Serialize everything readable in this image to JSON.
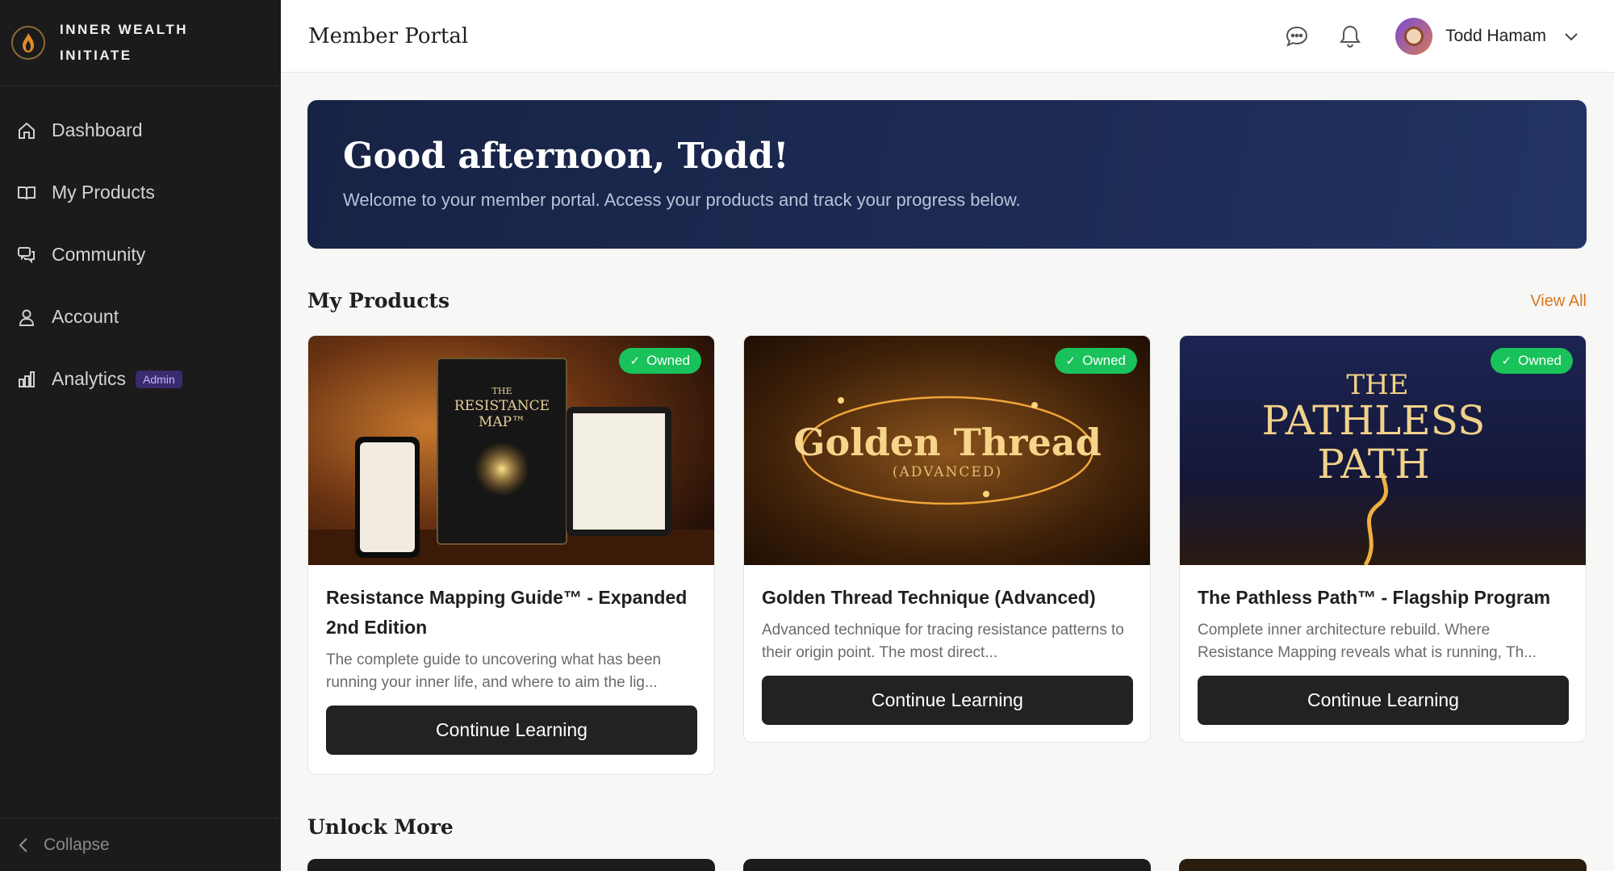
{
  "brand": {
    "line1": "INNER WEALTH",
    "line2": "INITIATE"
  },
  "sidebar": {
    "items": [
      {
        "label": "Dashboard",
        "icon": "home-icon"
      },
      {
        "label": "My Products",
        "icon": "book-icon"
      },
      {
        "label": "Community",
        "icon": "chat-icon"
      },
      {
        "label": "Account",
        "icon": "user-icon"
      },
      {
        "label": "Analytics",
        "icon": "bar-chart-icon",
        "badge": "Admin"
      }
    ],
    "collapse_label": "Collapse"
  },
  "header": {
    "title": "Member Portal",
    "user_name": "Todd Hamam"
  },
  "hero": {
    "title": "Good afternoon, Todd!",
    "subtitle": "Welcome to your member portal. Access your products and track your progress below."
  },
  "products": {
    "section_title": "My Products",
    "view_all": "View All",
    "cards": [
      {
        "badge": "Owned",
        "image_text": [
          "THE",
          "RESISTANCE",
          "MAP™"
        ],
        "title": "Resistance Mapping Guide™ - Expanded 2nd Edition",
        "description": "The complete guide to uncovering what has been running your inner life, and where to aim the lig...",
        "button": "Continue Learning"
      },
      {
        "badge": "Owned",
        "image_text": [
          "Golden Thread",
          "(ADVANCED)"
        ],
        "title": "Golden Thread Technique (Advanced)",
        "description": "Advanced technique for tracing resistance patterns to their origin point. The most direct...",
        "button": "Continue Learning"
      },
      {
        "badge": "Owned",
        "image_text": [
          "THE",
          "PATHLESS",
          "PATH"
        ],
        "title": "The Pathless Path™ - Flagship Program",
        "description": "Complete inner architecture rebuild. Where Resistance Mapping reveals what is running, Th...",
        "button": "Continue Learning"
      }
    ]
  },
  "unlock": {
    "section_title": "Unlock More"
  },
  "colors": {
    "sidebar_bg": "#1b1b1b",
    "accent": "#d9771f",
    "owned_badge": "#19c25a",
    "hero_bg": "#1d2b55",
    "button_bg": "#222222"
  }
}
